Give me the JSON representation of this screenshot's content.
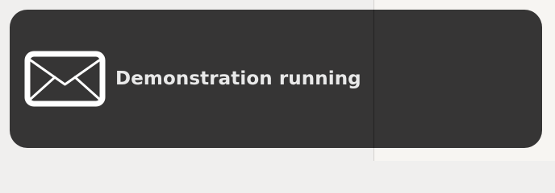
{
  "notification": {
    "icon": "mail-envelope-icon",
    "message": "Demonstration running",
    "colors": {
      "background": "#363535",
      "text": "#e9e9e9",
      "icon": "#ffffff"
    }
  }
}
